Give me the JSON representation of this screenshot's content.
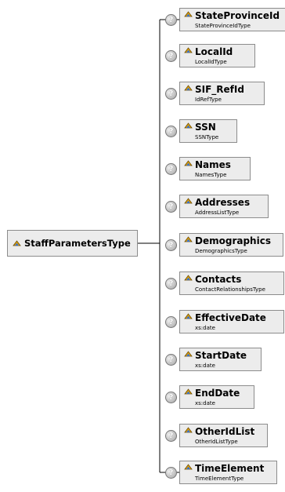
{
  "root": {
    "label": "StaffParametersType",
    "icon": "element-icon"
  },
  "help_icon": "question-mark-icon",
  "children": [
    {
      "name": "StateProvinceId",
      "type": "StateProvinceIdType"
    },
    {
      "name": "LocalId",
      "type": "LocalIdType"
    },
    {
      "name": "SIF_RefId",
      "type": "IdRefType"
    },
    {
      "name": "SSN",
      "type": "SSNType"
    },
    {
      "name": "Names",
      "type": "NamesType"
    },
    {
      "name": "Addresses",
      "type": "AddressListType"
    },
    {
      "name": "Demographics",
      "type": "DemographicsType"
    },
    {
      "name": "Contacts",
      "type": "ContactRelationshipsType"
    },
    {
      "name": "EffectiveDate",
      "type": "xs:date"
    },
    {
      "name": "StartDate",
      "type": "xs:date"
    },
    {
      "name": "EndDate",
      "type": "xs:date"
    },
    {
      "name": "OtherIdList",
      "type": "OtherIdListType"
    },
    {
      "name": "TimeElement",
      "type": "TimeElementType"
    }
  ]
}
